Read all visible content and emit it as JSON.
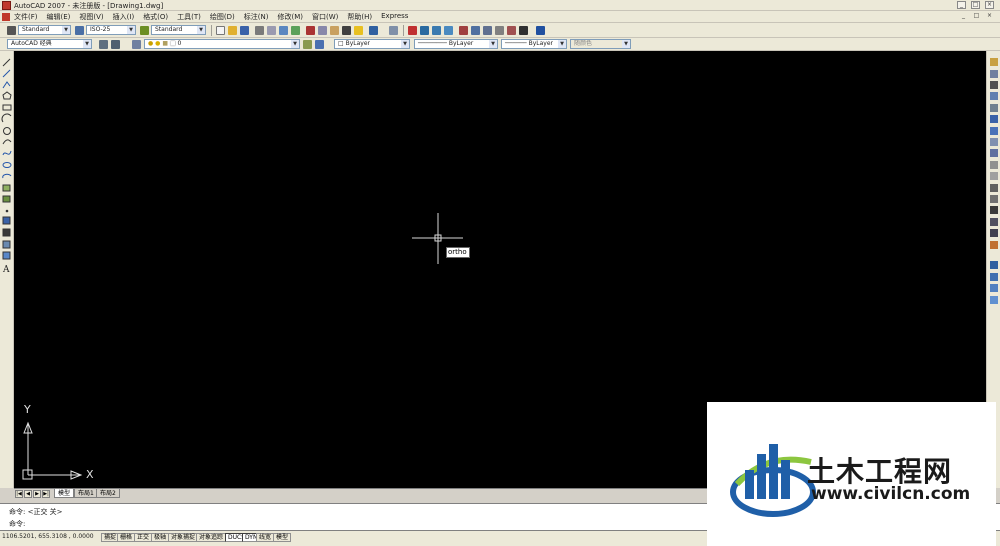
{
  "window": {
    "title": "AutoCAD 2007 - 未注册版 - [Drawing1.dwg]",
    "controls": [
      "_",
      "□",
      "×"
    ]
  },
  "menubar": {
    "items": [
      "文件(F)",
      "编辑(E)",
      "视图(V)",
      "插入(I)",
      "格式(O)",
      "工具(T)",
      "绘图(D)",
      "标注(N)",
      "修改(M)",
      "窗口(W)",
      "帮助(H)",
      "Express"
    ]
  },
  "toolbar1": {
    "text_style": "Standard",
    "dim_style": "ISO-25",
    "table_style": "Standard"
  },
  "toolbar2": {
    "workspace": "AutoCAD 经典",
    "layer": "0",
    "color": "ByLayer",
    "linetype": "ByLayer",
    "lineweight": "ByLayer",
    "plotstyle": "随颜色"
  },
  "canvas": {
    "background": "#000000",
    "tooltip_text": "ortho",
    "ucs_y": "Y",
    "ucs_x": "X"
  },
  "tabs": {
    "nav": [
      "|◀",
      "◀",
      "▶",
      "▶|"
    ],
    "items": [
      "模型",
      "布局1",
      "布局2"
    ],
    "active": "模型"
  },
  "command": {
    "line1": "命令:  <正交 关>",
    "line2": "命令:"
  },
  "status": {
    "coords": "1106.5201, 655.3108 , 0.0000",
    "buttons": [
      "捕捉",
      "栅格",
      "正交",
      "极轴",
      "对象捕捉",
      "对象追踪",
      "DUCS",
      "DYN",
      "线宽",
      "模型"
    ]
  },
  "watermark": {
    "name": "土木工程网",
    "url": "www.civilcn.com",
    "blue": "#1f5fa8",
    "green": "#8cc63f"
  }
}
